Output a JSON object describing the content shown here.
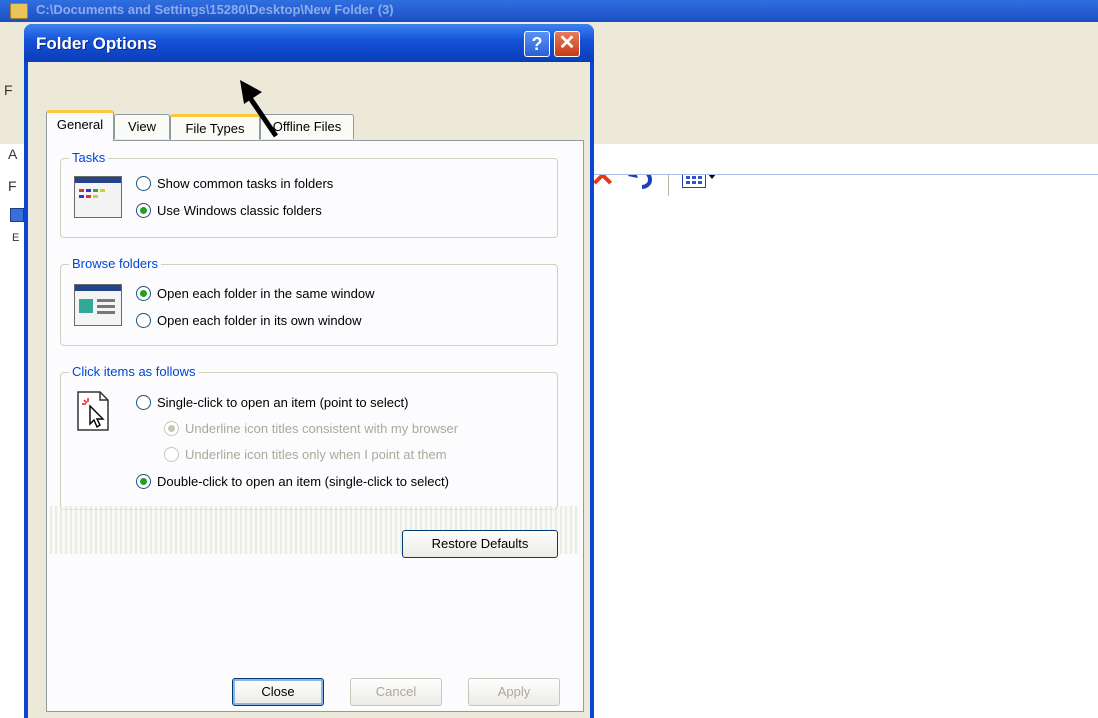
{
  "background_window": {
    "title": "C:\\Documents and Settings\\15280\\Desktop\\New Folder (3)",
    "left_pane_letters": [
      "F",
      "A",
      "F",
      "E"
    ]
  },
  "dialog": {
    "title": "Folder Options",
    "help_label": "?",
    "close_label": "✕",
    "tabs": [
      {
        "label": "General",
        "active": true
      },
      {
        "label": "View",
        "active": false
      },
      {
        "label": "File Types",
        "active": false
      },
      {
        "label": "Offline Files",
        "active": false
      }
    ],
    "tasks": {
      "legend": "Tasks",
      "options": [
        {
          "label": "Show common tasks in folders",
          "checked": false
        },
        {
          "label": "Use Windows classic folders",
          "checked": true
        }
      ]
    },
    "browse": {
      "legend": "Browse folders",
      "options": [
        {
          "label": "Open each folder in the same window",
          "checked": true
        },
        {
          "label": "Open each folder in its own window",
          "checked": false
        }
      ]
    },
    "click_items": {
      "legend": "Click items as follows",
      "options": [
        {
          "label": "Single-click to open an item (point to select)",
          "checked": false
        },
        {
          "label": "Underline icon titles consistent with my browser",
          "checked": true,
          "disabled": true
        },
        {
          "label": "Underline icon titles only when I point at them",
          "checked": false,
          "disabled": true
        },
        {
          "label": "Double-click to open an item (single-click to select)",
          "checked": true
        }
      ]
    },
    "restore_defaults_label": "Restore Defaults",
    "buttons": {
      "close": "Close",
      "cancel": "Cancel",
      "apply": "Apply"
    }
  },
  "colors": {
    "title_bar": "#0a46d0",
    "legend_text": "#0046d5",
    "dialog_face": "#ece9d8"
  }
}
